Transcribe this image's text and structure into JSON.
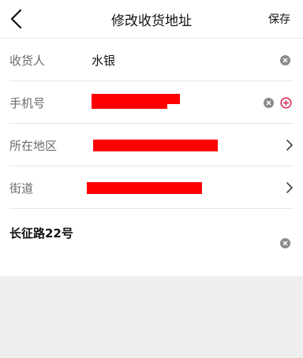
{
  "header": {
    "title": "修改收货地址",
    "save_label": "保存",
    "back_icon": "chevron-left-icon"
  },
  "form": {
    "recipient": {
      "label": "收货人",
      "value": "水银"
    },
    "phone": {
      "label": "手机号",
      "value": ""
    },
    "region": {
      "label": "所在地区",
      "value": ""
    },
    "street": {
      "label": "街道",
      "value": ""
    },
    "detail_address": {
      "value": "长征路22号"
    }
  },
  "colors": {
    "accent": "#e0224f",
    "redaction": "#ff0000",
    "background": "#efefef"
  }
}
